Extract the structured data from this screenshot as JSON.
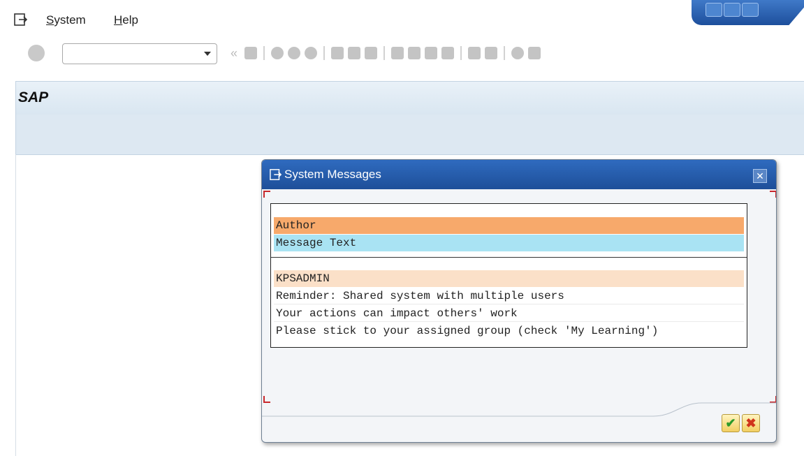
{
  "menubar": {
    "items": [
      {
        "label_pre": "",
        "label_ul": "S",
        "label_post": "ystem"
      },
      {
        "label_pre": "",
        "label_ul": "H",
        "label_post": "elp"
      }
    ]
  },
  "toolbar": {
    "command_field_value": "",
    "icons": [
      "back-icon",
      "save-icon",
      "back-nav-icon",
      "exit-icon",
      "cancel-icon",
      "print-icon",
      "find-icon",
      "find-next-icon",
      "first-page-icon",
      "previous-page-icon",
      "next-page-icon",
      "last-page-icon",
      "create-session-icon",
      "shortcut-icon",
      "help-icon",
      "layout-icon"
    ]
  },
  "header": {
    "title": "SAP"
  },
  "dialog": {
    "title": "System Messages",
    "column_labels": {
      "author": "Author",
      "message_text": "Message Text"
    },
    "author": "KPSADMIN",
    "lines": [
      "Reminder: Shared system with multiple users",
      "Your actions can impact others' work",
      "Please stick to your assigned group (check 'My Learning')"
    ],
    "ok_symbol": "✔",
    "cancel_symbol": "✖",
    "close_symbol": "✕"
  },
  "colors": {
    "author_header": "#f7a96b",
    "message_header": "#a9e3f3",
    "author_row": "#fbe0c8",
    "title_bar": "#1e4f99"
  }
}
